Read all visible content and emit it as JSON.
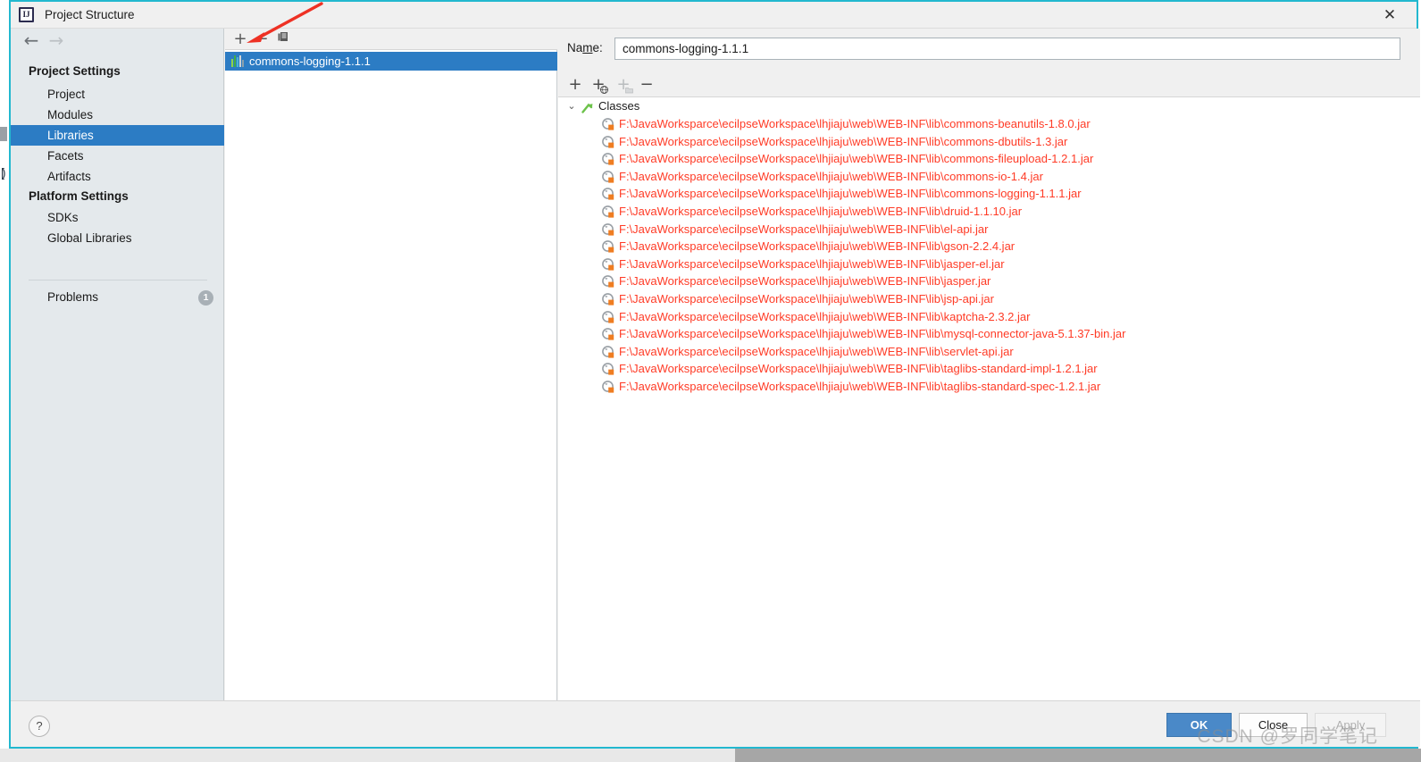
{
  "window": {
    "title": "Project Structure",
    "app_icon": "intellij-idea-icon",
    "close_icon": "✕",
    "accent_border": "#22b8cf"
  },
  "nav": {
    "back_icon": "←",
    "forward_icon": "→"
  },
  "sidebar": {
    "groups": [
      {
        "label": "Project Settings"
      },
      {
        "label": "Platform Settings"
      }
    ],
    "project_settings_items": [
      {
        "label": "Project",
        "selected": false
      },
      {
        "label": "Modules",
        "selected": false
      },
      {
        "label": "Libraries",
        "selected": true
      },
      {
        "label": "Facets",
        "selected": false
      },
      {
        "label": "Artifacts",
        "selected": false
      }
    ],
    "platform_settings_items": [
      {
        "label": "SDKs",
        "selected": false
      },
      {
        "label": "Global Libraries",
        "selected": false
      }
    ],
    "problems": {
      "label": "Problems",
      "count": "1"
    },
    "selected_color": "#2c7cc4"
  },
  "library_panel": {
    "toolbar": {
      "add_label": "+",
      "remove_label": "−",
      "copy_label": "⎘"
    },
    "items": [
      {
        "label": "commons-logging-1.1.1",
        "selected": true
      }
    ]
  },
  "detail": {
    "name_label_pre": "Na",
    "name_label_accel": "m",
    "name_label_post": "e:",
    "name_value": "commons-logging-1.1.1",
    "classes_toolbar": {
      "add_label": "+",
      "add_url_label": "+",
      "add_dir_label": "+",
      "remove_label": "−"
    },
    "tree": {
      "expand_icon": "⌄",
      "root_label": "Classes",
      "entries": [
        "F:\\JavaWorksparce\\ecilpseWorkspace\\lhjiaju\\web\\WEB-INF\\lib\\commons-beanutils-1.8.0.jar",
        "F:\\JavaWorksparce\\ecilpseWorkspace\\lhjiaju\\web\\WEB-INF\\lib\\commons-dbutils-1.3.jar",
        "F:\\JavaWorksparce\\ecilpseWorkspace\\lhjiaju\\web\\WEB-INF\\lib\\commons-fileupload-1.2.1.jar",
        "F:\\JavaWorksparce\\ecilpseWorkspace\\lhjiaju\\web\\WEB-INF\\lib\\commons-io-1.4.jar",
        "F:\\JavaWorksparce\\ecilpseWorkspace\\lhjiaju\\web\\WEB-INF\\lib\\commons-logging-1.1.1.jar",
        "F:\\JavaWorksparce\\ecilpseWorkspace\\lhjiaju\\web\\WEB-INF\\lib\\druid-1.1.10.jar",
        "F:\\JavaWorksparce\\ecilpseWorkspace\\lhjiaju\\web\\WEB-INF\\lib\\el-api.jar",
        "F:\\JavaWorksparce\\ecilpseWorkspace\\lhjiaju\\web\\WEB-INF\\lib\\gson-2.2.4.jar",
        "F:\\JavaWorksparce\\ecilpseWorkspace\\lhjiaju\\web\\WEB-INF\\lib\\jasper-el.jar",
        "F:\\JavaWorksparce\\ecilpseWorkspace\\lhjiaju\\web\\WEB-INF\\lib\\jasper.jar",
        "F:\\JavaWorksparce\\ecilpseWorkspace\\lhjiaju\\web\\WEB-INF\\lib\\jsp-api.jar",
        "F:\\JavaWorksparce\\ecilpseWorkspace\\lhjiaju\\web\\WEB-INF\\lib\\kaptcha-2.3.2.jar",
        "F:\\JavaWorksparce\\ecilpseWorkspace\\lhjiaju\\web\\WEB-INF\\lib\\mysql-connector-java-5.1.37-bin.jar",
        "F:\\JavaWorksparce\\ecilpseWorkspace\\lhjiaju\\web\\WEB-INF\\lib\\servlet-api.jar",
        "F:\\JavaWorksparce\\ecilpseWorkspace\\lhjiaju\\web\\WEB-INF\\lib\\taglibs-standard-impl-1.2.1.jar",
        "F:\\JavaWorksparce\\ecilpseWorkspace\\lhjiaju\\web\\WEB-INF\\lib\\taglibs-standard-spec-1.2.1.jar"
      ],
      "entry_color": "#ff3b26"
    }
  },
  "footer": {
    "help_label": "?",
    "ok_label": "OK",
    "close_label": "Close",
    "apply_label": "Apply"
  },
  "watermark": "CSDN @罗同学笔记"
}
